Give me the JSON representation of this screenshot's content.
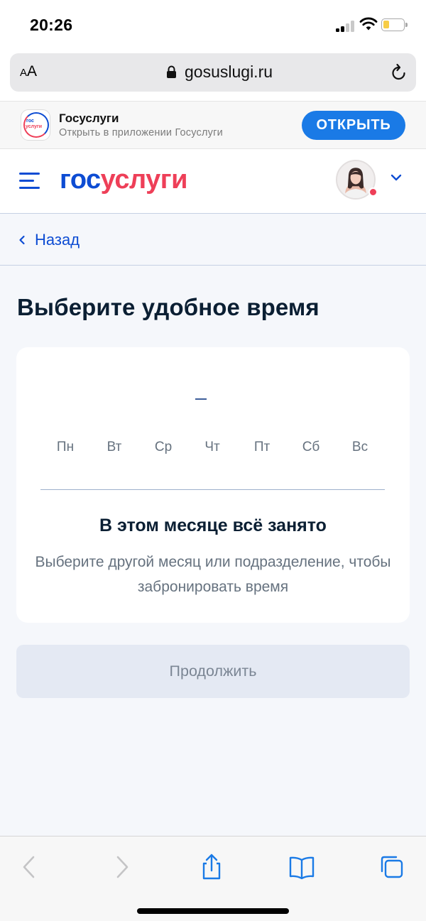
{
  "status_bar": {
    "time": "20:26"
  },
  "browser": {
    "text_size_label_small": "A",
    "text_size_label_large": "A",
    "url": "gosuslugi.ru"
  },
  "app_banner": {
    "title": "Госуслуги",
    "subtitle": "Открыть в приложении Госуслуги",
    "open_label": "ОТКРЫТЬ",
    "logo_top": "гос",
    "logo_bottom": "услуги"
  },
  "header": {
    "logo_part1": "гос",
    "logo_part2": "услуги"
  },
  "nav": {
    "back_label": "Назад"
  },
  "main": {
    "title": "Выберите удобное время",
    "calendar": {
      "month_label": "–",
      "weekdays": [
        "Пн",
        "Вт",
        "Ср",
        "Чт",
        "Пт",
        "Сб",
        "Вс"
      ],
      "empty_title": "В этом месяце всё занято",
      "empty_text": "Выберите другой месяц или подразделение, чтобы забронировать время"
    },
    "continue_label": "Продолжить"
  },
  "colors": {
    "brand_blue": "#0d4cd3",
    "brand_red": "#ee3f58",
    "ios_button_blue": "#1a7ae6",
    "page_bg": "#f5f7fb"
  }
}
